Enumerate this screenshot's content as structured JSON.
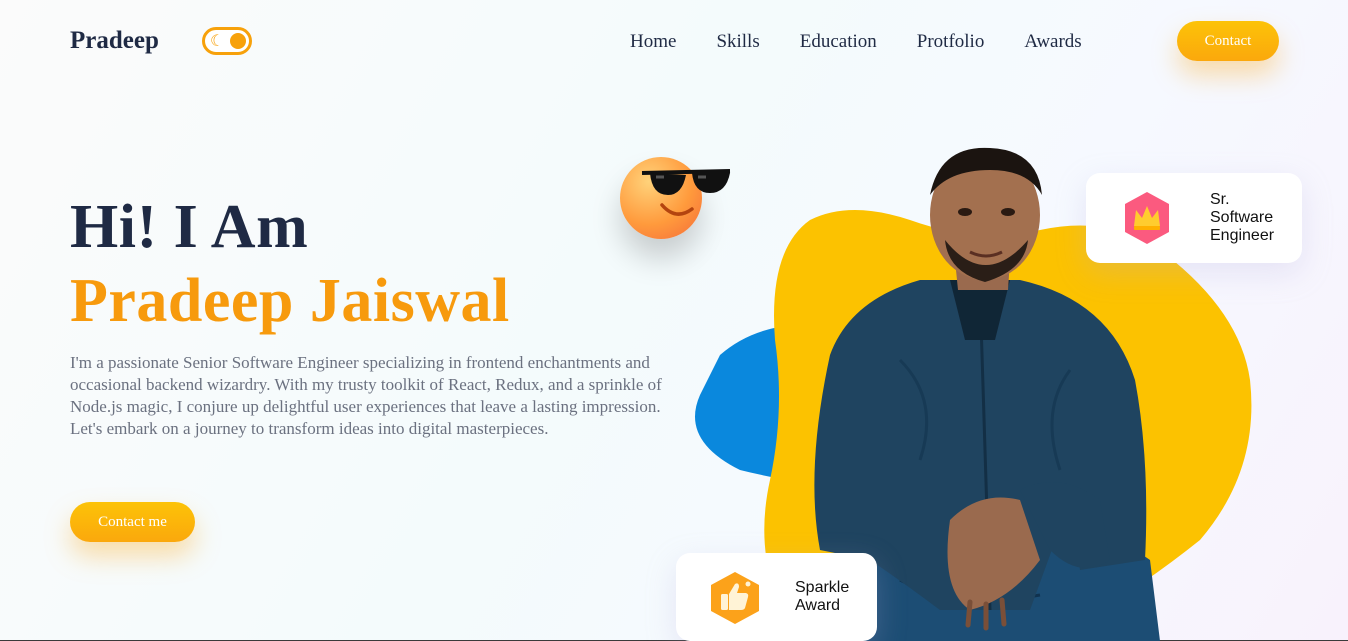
{
  "brand": {
    "name": "Pradeep"
  },
  "theme_toggle": {
    "icon": "moon-icon",
    "accent": "#f7a10b"
  },
  "nav": {
    "items": [
      {
        "label": "Home"
      },
      {
        "label": "Skills"
      },
      {
        "label": "Education"
      },
      {
        "label": "Protfolio"
      },
      {
        "label": "Awards"
      }
    ],
    "contact_label": "Contact"
  },
  "hero": {
    "greeting": "Hi! I Am",
    "name": "Pradeep Jaiswal",
    "description": "I'm a passionate Senior Software Engineer specializing in frontend enchantments and occasional backend wizardry. With my trusty toolkit of React, Redux, and a sprinkle of Node.js magic, I conjure up delightful user experiences that leave a lasting impression. Let's embark on a journey to transform ideas into digital masterpieces.",
    "cta_label": "Contact me"
  },
  "badges": {
    "role": {
      "text": "Sr. Software Engineer",
      "icon": "crown-icon"
    },
    "award": {
      "text": "Sparkle Award",
      "icon": "thumbs-up-icon"
    }
  },
  "colors": {
    "dark": "#1f2a44",
    "accent_orange": "#f79a0d",
    "button_yellow": "#fcc308",
    "blob_yellow": "#fcc200",
    "blob_blue": "#0a88dd",
    "text_muted": "#6b7180"
  }
}
